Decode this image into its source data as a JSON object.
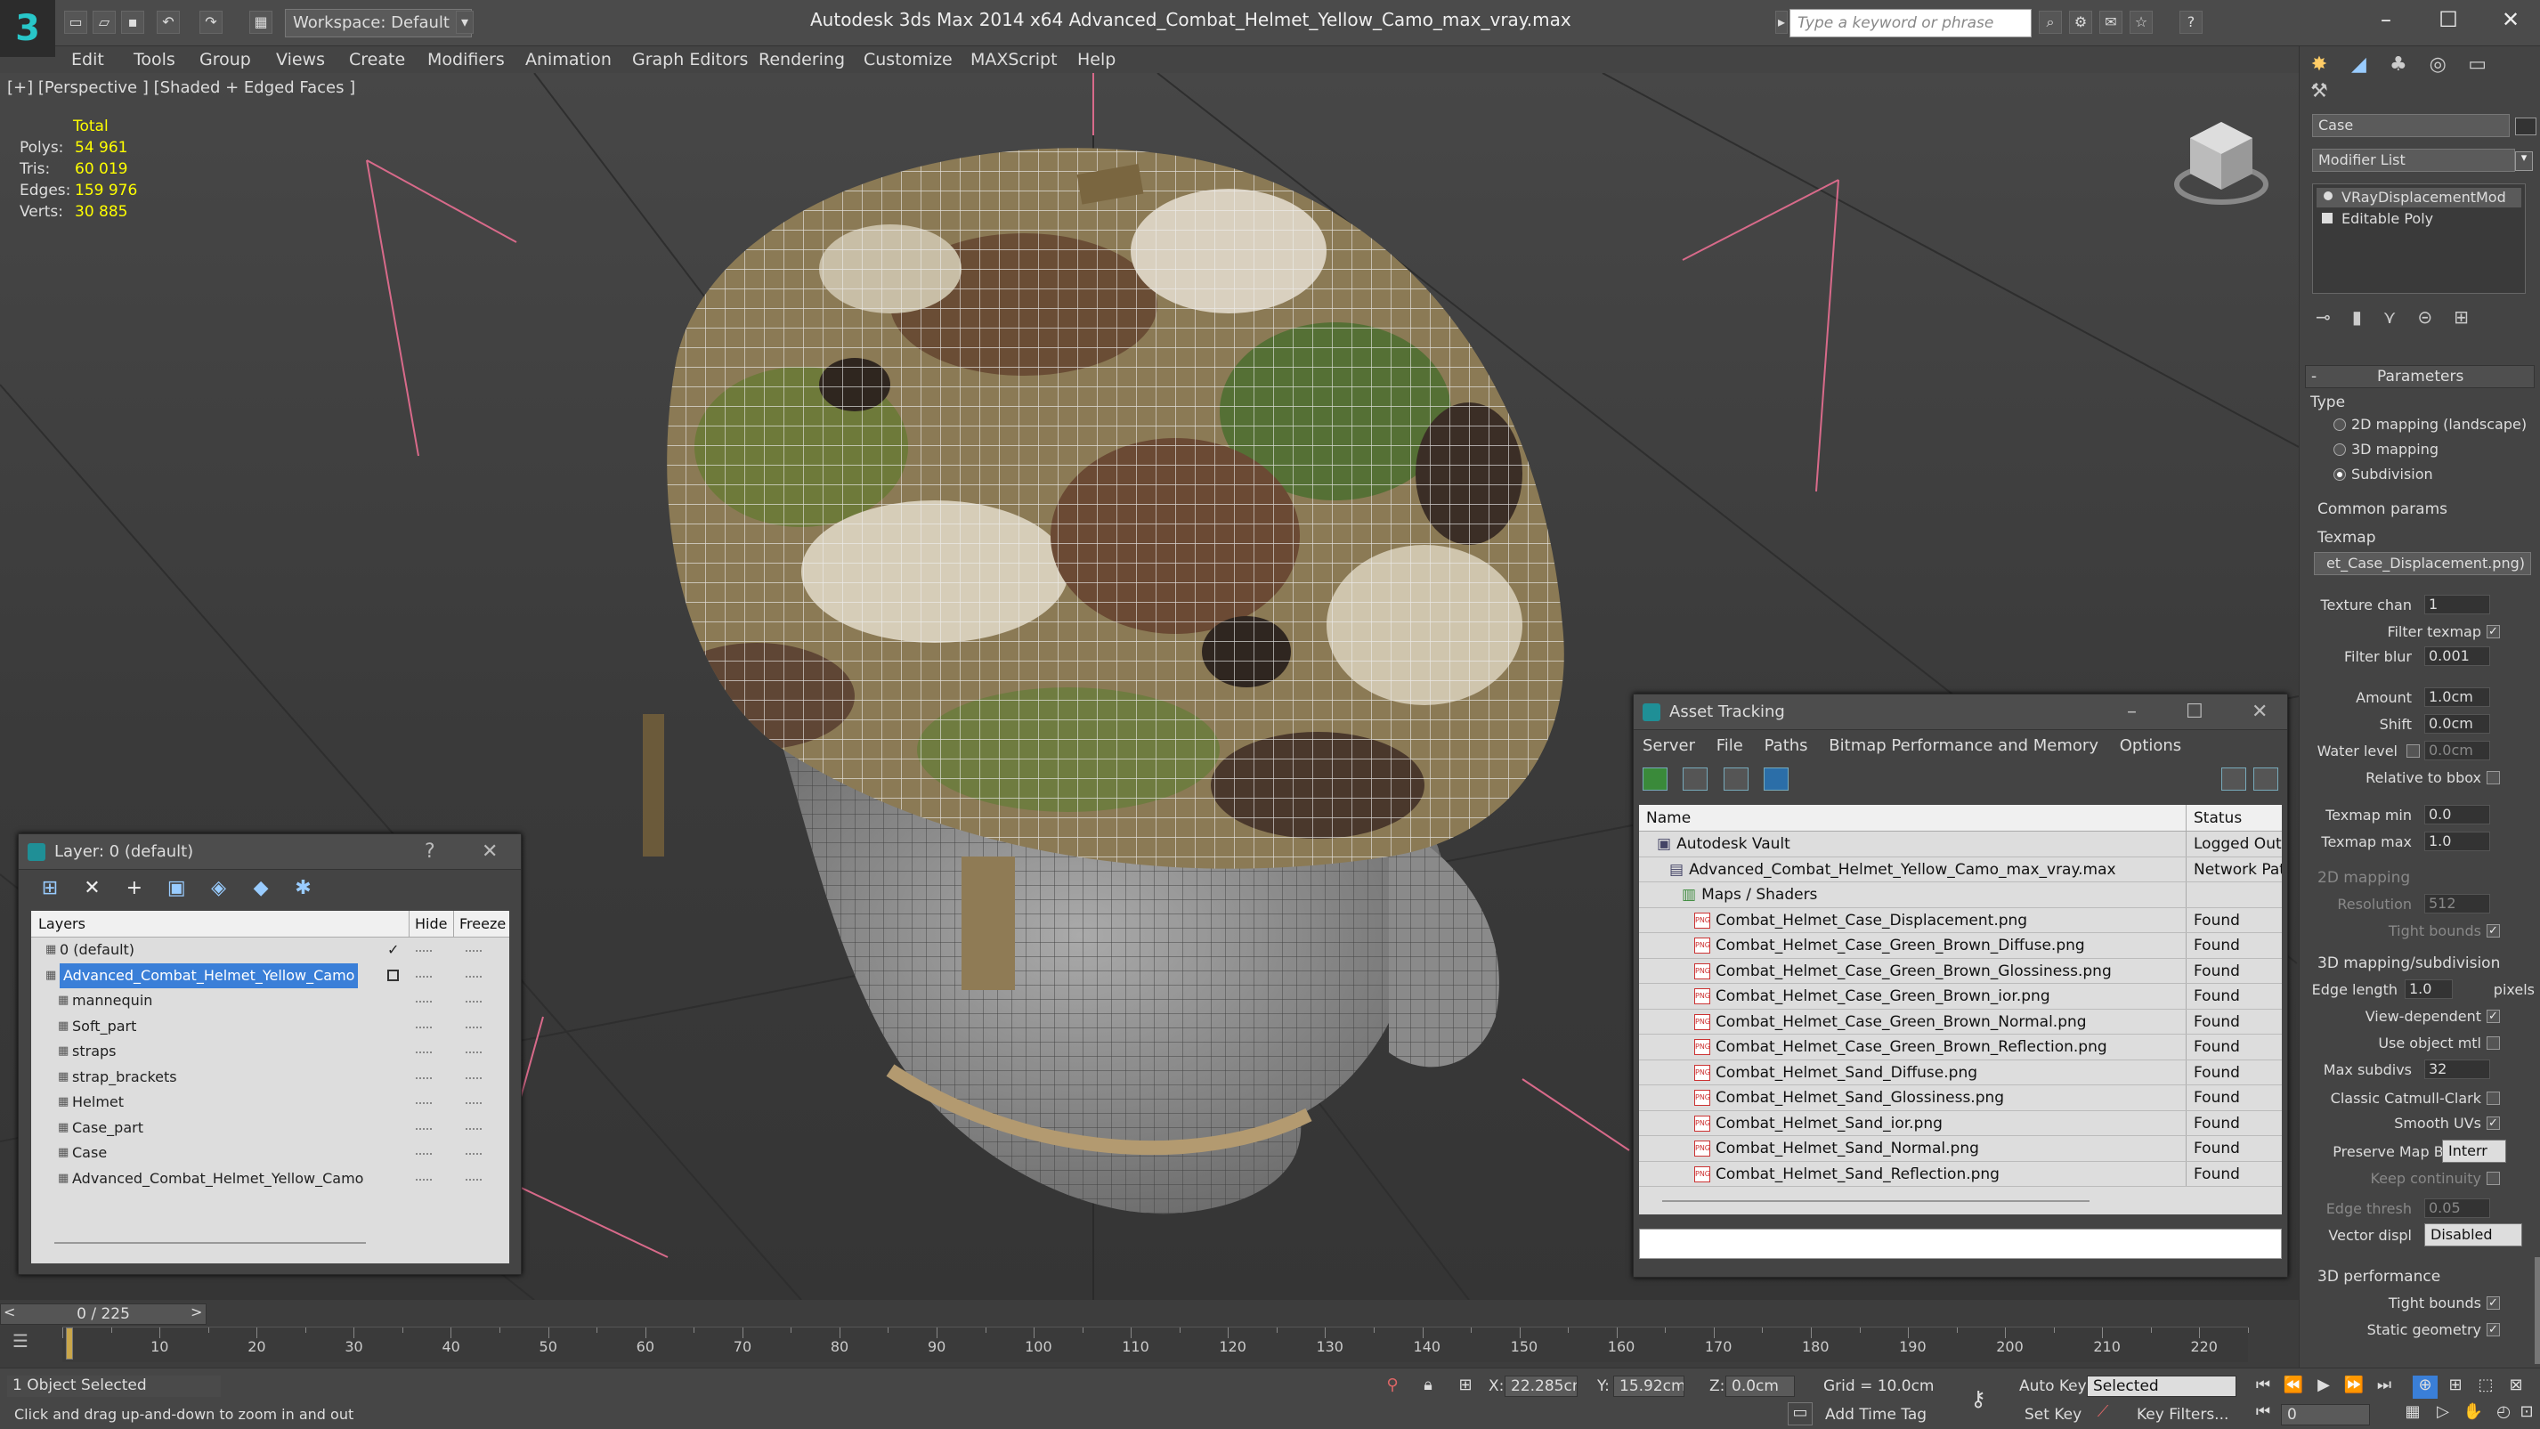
{
  "app": {
    "logo": "3",
    "workspace": "Workspace: Default",
    "title": "Autodesk 3ds Max  2014 x64     Advanced_Combat_Helmet_Yellow_Camo_max_vray.max",
    "search_placeholder": "Type a keyword or phrase"
  },
  "menu": [
    "Edit",
    "Tools",
    "Group",
    "Views",
    "Create",
    "Modifiers",
    "Animation",
    "Graph Editors",
    "Rendering",
    "Customize",
    "MAXScript",
    "Help"
  ],
  "viewport": {
    "label": "[+] [Perspective ] [Shaded + Edged Faces ]",
    "stats_header": "Total",
    "stats": [
      {
        "key": "Polys:",
        "value": "54 961"
      },
      {
        "key": "Tris:",
        "value": "60 019"
      },
      {
        "key": "Edges:",
        "value": "159 976"
      },
      {
        "key": "Verts:",
        "value": "30 885"
      }
    ]
  },
  "layer_panel": {
    "title": "Layer: 0 (default)",
    "col_layers": "Layers",
    "col_hide": "Hide",
    "col_freeze": "Freeze",
    "rows": [
      {
        "name": "0 (default)",
        "indent": 0,
        "check": "✓"
      },
      {
        "name": "Advanced_Combat_Helmet_Yellow_Camo",
        "indent": 0,
        "selected": true
      },
      {
        "name": "mannequin",
        "indent": 1
      },
      {
        "name": "Soft_part",
        "indent": 1
      },
      {
        "name": "straps",
        "indent": 1
      },
      {
        "name": "strap_brackets",
        "indent": 1
      },
      {
        "name": "Helmet",
        "indent": 1
      },
      {
        "name": "Case_part",
        "indent": 1
      },
      {
        "name": "Case",
        "indent": 1
      },
      {
        "name": "Advanced_Combat_Helmet_Yellow_Camo",
        "indent": 1
      }
    ]
  },
  "asset_panel": {
    "title": "Asset Tracking",
    "menu": [
      "Server",
      "File",
      "Paths",
      "Bitmap Performance and Memory",
      "Options"
    ],
    "col_name": "Name",
    "col_status": "Status",
    "rows": [
      {
        "name": "Autodesk Vault",
        "status": "Logged Out",
        "level": 0,
        "kind": "vault"
      },
      {
        "name": "Advanced_Combat_Helmet_Yellow_Camo_max_vray.max",
        "status": "Network Pat",
        "level": 1,
        "kind": "max"
      },
      {
        "name": "Maps / Shaders",
        "status": "",
        "level": 2,
        "kind": "maps"
      },
      {
        "name": "Combat_Helmet_Case_Displacement.png",
        "status": "Found",
        "level": 3,
        "kind": "png"
      },
      {
        "name": "Combat_Helmet_Case_Green_Brown_Diffuse.png",
        "status": "Found",
        "level": 3,
        "kind": "png"
      },
      {
        "name": "Combat_Helmet_Case_Green_Brown_Glossiness.png",
        "status": "Found",
        "level": 3,
        "kind": "png"
      },
      {
        "name": "Combat_Helmet_Case_Green_Brown_ior.png",
        "status": "Found",
        "level": 3,
        "kind": "png"
      },
      {
        "name": "Combat_Helmet_Case_Green_Brown_Normal.png",
        "status": "Found",
        "level": 3,
        "kind": "png"
      },
      {
        "name": "Combat_Helmet_Case_Green_Brown_Reflection.png",
        "status": "Found",
        "level": 3,
        "kind": "png"
      },
      {
        "name": "Combat_Helmet_Sand_Diffuse.png",
        "status": "Found",
        "level": 3,
        "kind": "png"
      },
      {
        "name": "Combat_Helmet_Sand_Glossiness.png",
        "status": "Found",
        "level": 3,
        "kind": "png"
      },
      {
        "name": "Combat_Helmet_Sand_ior.png",
        "status": "Found",
        "level": 3,
        "kind": "png"
      },
      {
        "name": "Combat_Helmet_Sand_Normal.png",
        "status": "Found",
        "level": 3,
        "kind": "png"
      },
      {
        "name": "Combat_Helmet_Sand_Reflection.png",
        "status": "Found",
        "level": 3,
        "kind": "png"
      }
    ]
  },
  "command_panel": {
    "object_name": "Case",
    "modifier_list": "Modifier List",
    "stack": [
      "VRayDisplacementMod",
      "Editable Poly"
    ],
    "parameters": "Parameters",
    "type_label": "Type",
    "type_options": [
      "2D mapping (landscape)",
      "3D mapping",
      "Subdivision"
    ],
    "common_params": "Common params",
    "texmap_label": "Texmap",
    "texmap_value": "et_Case_Displacement.png)",
    "texture_chan_label": "Texture chan",
    "texture_chan": "1",
    "filter_texmap": "Filter texmap",
    "filter_blur_label": "Filter blur",
    "filter_blur": "0.001",
    "amount_label": "Amount",
    "amount": "1.0cm",
    "shift_label": "Shift",
    "shift": "0.0cm",
    "water_level_label": "Water level",
    "water_level": "0.0cm",
    "relative_bbox": "Relative to bbox",
    "texmap_min_label": "Texmap min",
    "texmap_min": "0.0",
    "texmap_max_label": "Texmap max",
    "texmap_max": "1.0",
    "mapping_2d": "2D mapping",
    "resolution_label": "Resolution",
    "resolution": "512",
    "tight_bounds": "Tight bounds",
    "mapping_3d_sub": "3D mapping/subdivision",
    "edge_length_label": "Edge length",
    "edge_length": "1.0",
    "pixels": "pixels",
    "view_dependent": "View-dependent",
    "use_object_mtl": "Use object mtl",
    "max_subdivs_label": "Max subdivs",
    "max_subdivs": "32",
    "classic_catmull": "Classic Catmull-Clark",
    "smooth_uvs": "Smooth UVs",
    "preserve_map_label": "Preserve Map Bnd",
    "preserve_map": "Interr",
    "keep_continuity": "Keep continuity",
    "edge_thresh_label": "Edge thresh",
    "edge_thresh": "0.05",
    "vector_displ_label": "Vector displ",
    "vector_displ": "Disabled",
    "perf_3d": "3D performance",
    "tight_bounds_2": "Tight bounds",
    "static_geometry": "Static geometry"
  },
  "timeline": {
    "frames": "0 / 225",
    "ticks": [
      "10",
      "20",
      "30",
      "40",
      "50",
      "60",
      "70",
      "80",
      "90",
      "100",
      "110",
      "120",
      "130",
      "140",
      "150",
      "160",
      "170",
      "180",
      "190",
      "200",
      "210",
      "220"
    ]
  },
  "status": {
    "selection": "1 Object Selected",
    "hint": "Click and drag up-and-down to zoom in and out",
    "x_label": "X:",
    "x": "22.285cm",
    "y_label": "Y:",
    "y": "15.92cm",
    "z_label": "Z:",
    "z": "0.0cm",
    "grid": "Grid = 10.0cm",
    "auto_key": "Auto Key",
    "selected": "Selected",
    "set_key": "Set Key",
    "key_filters": "Key Filters...",
    "add_time_tag": "Add Time Tag",
    "frame": "0"
  }
}
